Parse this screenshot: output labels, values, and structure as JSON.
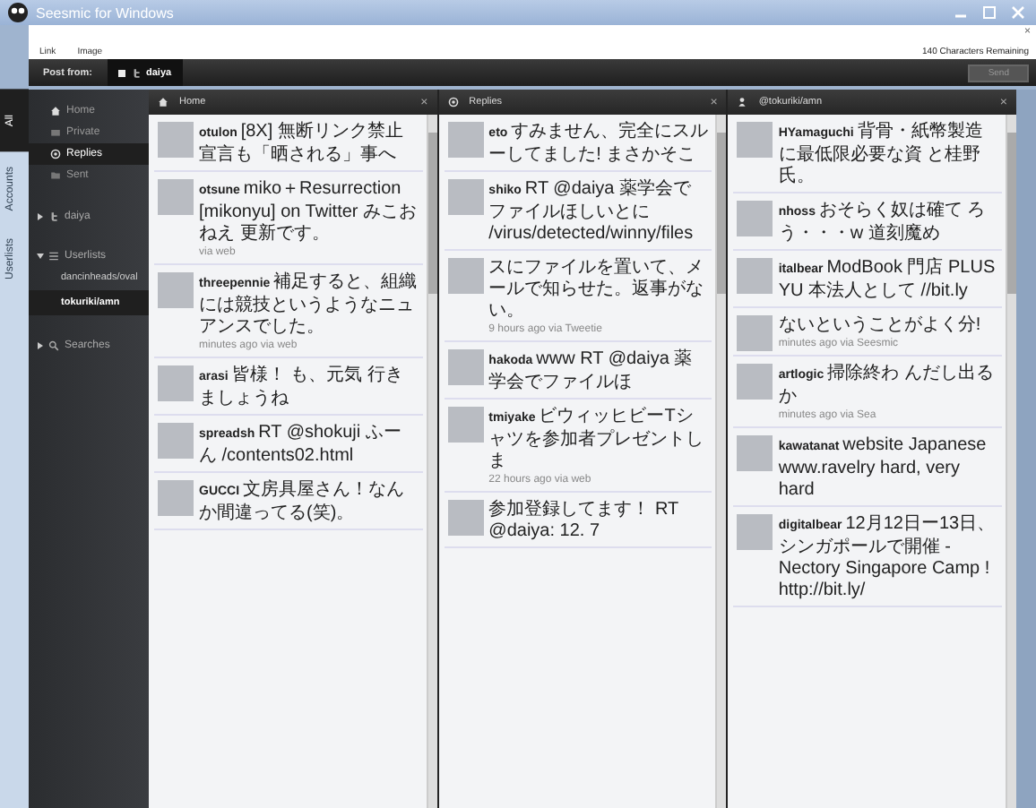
{
  "window": {
    "title": "Seesmic for Windows"
  },
  "compose": {
    "links": [
      "Link",
      "Image"
    ],
    "counter": "140 Characters Remaining",
    "close": "×"
  },
  "post_bar": {
    "label": "Post from:",
    "account": {
      "name": "daiya",
      "checked": true
    },
    "send": "Send"
  },
  "side_tabs": [
    {
      "label": "All",
      "selected": true
    },
    {
      "label": "Accounts",
      "selected": false
    },
    {
      "label": "Userlists",
      "selected": false
    }
  ],
  "sidebar": {
    "items": [
      {
        "label": "Home",
        "kind": "home",
        "selected": false
      },
      {
        "label": "Private",
        "kind": "private",
        "selected": false
      },
      {
        "label": "Replies",
        "kind": "replies",
        "selected": true
      },
      {
        "label": "Sent",
        "kind": "sent",
        "selected": false
      }
    ],
    "groups": [
      {
        "label": "daiya",
        "kind": "account",
        "expanded": false
      },
      {
        "label": "Userlists",
        "kind": "userlists",
        "expanded": true,
        "children": [
          {
            "label": "dancinheads/oval",
            "selected": false
          },
          {
            "label": "tokuriki/amn",
            "selected": true
          }
        ]
      },
      {
        "label": "Searches",
        "kind": "searches",
        "expanded": false
      }
    ]
  },
  "columns": [
    {
      "title": "Home",
      "kind": "home",
      "close": "×",
      "tweets": [
        {
          "user": "otulon",
          "text": "[8X] 無断リンク禁止宣言も「晒される」事へ"
        },
        {
          "user": "otsune",
          "text": "miko＋Resurrection [mikonyu] on Twitter みこおねえ 更新です。",
          "meta": "via web"
        },
        {
          "user": "threepennie",
          "text": "補足すると、組織には競技というようなニュアンスでした。",
          "meta": "minutes ago via web"
        },
        {
          "user": "arasi",
          "text": "皆様！ も、元気 行きましょうね"
        },
        {
          "user": "spreadsh",
          "text": "RT @shokuji ふーん /contents02.html"
        },
        {
          "user": "GUCCI",
          "text": "文房具屋さん！なんか間違ってる(笑)。"
        }
      ]
    },
    {
      "title": "Replies",
      "kind": "replies",
      "close": "×",
      "tweets": [
        {
          "user": "eto",
          "text": "すみません、完全にスルーしてました! まさかそこ"
        },
        {
          "user": "shiko",
          "text": "RT @daiya 薬学会でファイルほしいとに /virus/detected/winny/files"
        },
        {
          "text": "スにファイルを置いて、メールで知らせた。返事がない。",
          "meta": "9 hours ago via Tweetie"
        },
        {
          "user": "hakoda",
          "text": "www RT @daiya 薬学会でファイルほ"
        },
        {
          "user": "tmiyake",
          "text": "ビウィッヒビーTシャツを参加者プレゼントしま",
          "meta": "22 hours ago via web"
        },
        {
          "text": "参加登録してます！ RT @daiya: 12. 7"
        }
      ]
    },
    {
      "title": "@tokuriki/amn",
      "kind": "list",
      "close": "×",
      "tweets": [
        {
          "user": "HYamaguchi",
          "text": "背骨・紙幣製造に最低限必要な資 と桂野氏。"
        },
        {
          "user": "nhoss",
          "text": "おそらく奴は確て ろう・・・w 道刻魔め"
        },
        {
          "user": "italbear",
          "text": "ModBook 門店 PLUS YU 本法人として //bit.ly"
        },
        {
          "text": "ないということがよく分!",
          "meta": "minutes ago via Seesmic"
        },
        {
          "user": "artlogic",
          "text": "掃除終わ んだし出るか",
          "meta": "minutes ago via Sea"
        },
        {
          "user": "kawatanat",
          "text": "website Japanese www.ravelry hard, very hard"
        },
        {
          "user": "digitalbear",
          "text": "12月12日ー13日、シンガポールで開催 - Nectory Singapore Camp ! http://bit.ly/"
        }
      ]
    }
  ]
}
